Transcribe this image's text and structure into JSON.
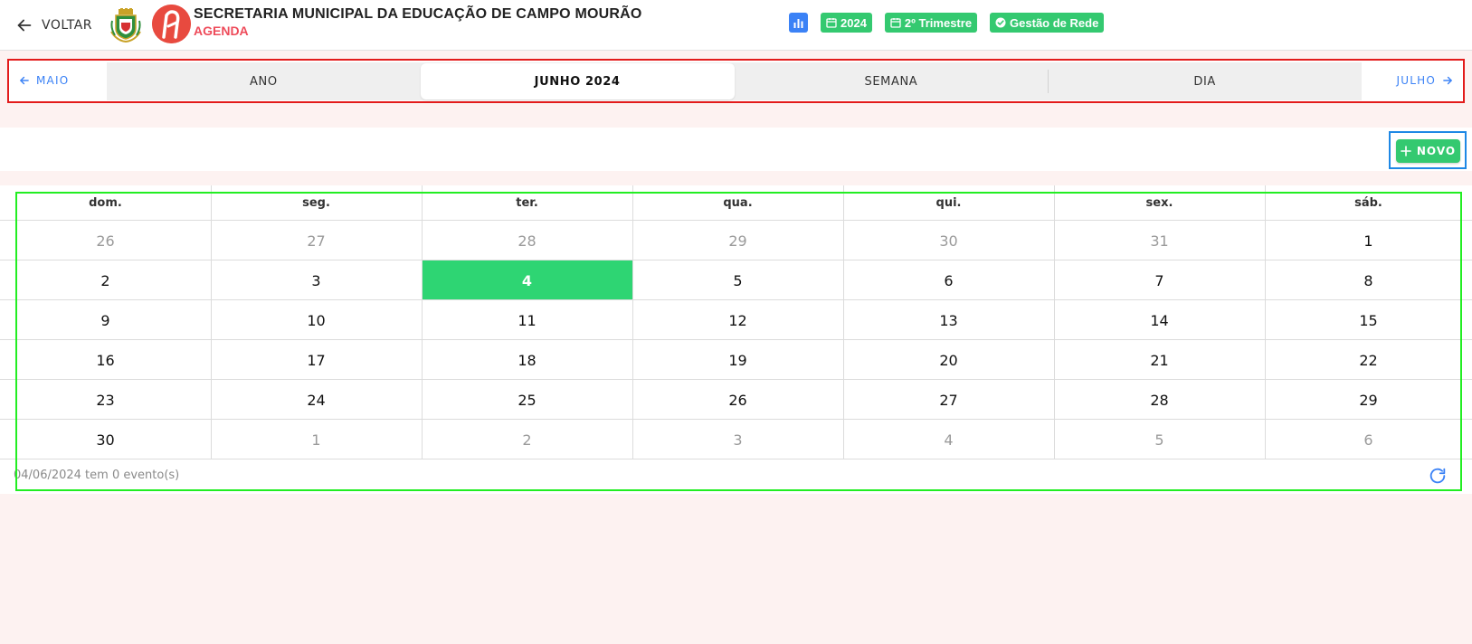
{
  "header": {
    "back_label": "VOLTAR",
    "org_title": "SECRETARIA MUNICIPAL DA EDUCAÇÃO DE CAMPO MOURÃO",
    "org_subtitle": "AGENDA",
    "badges": [
      {
        "icon": "bar-chart-icon",
        "label": ""
      },
      {
        "icon": "calendar-icon",
        "label": "2024"
      },
      {
        "icon": "calendar-icon",
        "label": "2º Trimestre"
      },
      {
        "icon": "check-circle-icon",
        "label": "Gestão de Rede"
      }
    ]
  },
  "nav": {
    "prev_label": "MAIO",
    "next_label": "JULHO",
    "tabs": [
      {
        "label": "ANO",
        "active": false
      },
      {
        "label": "JUNHO 2024",
        "active": true
      },
      {
        "label": "SEMANA",
        "active": false
      },
      {
        "label": "DIA",
        "active": false
      }
    ]
  },
  "toolbar": {
    "new_label": "NOVO"
  },
  "calendar": {
    "weekdays": [
      "dom.",
      "seg.",
      "ter.",
      "qua.",
      "qui.",
      "sex.",
      "sáb."
    ],
    "weeks": [
      [
        {
          "d": "26",
          "o": true
        },
        {
          "d": "27",
          "o": true
        },
        {
          "d": "28",
          "o": true
        },
        {
          "d": "29",
          "o": true
        },
        {
          "d": "30",
          "o": true
        },
        {
          "d": "31",
          "o": true
        },
        {
          "d": "1",
          "o": false
        }
      ],
      [
        {
          "d": "2",
          "o": false
        },
        {
          "d": "3",
          "o": false
        },
        {
          "d": "4",
          "o": false,
          "today": true
        },
        {
          "d": "5",
          "o": false
        },
        {
          "d": "6",
          "o": false
        },
        {
          "d": "7",
          "o": false
        },
        {
          "d": "8",
          "o": false
        }
      ],
      [
        {
          "d": "9",
          "o": false
        },
        {
          "d": "10",
          "o": false
        },
        {
          "d": "11",
          "o": false
        },
        {
          "d": "12",
          "o": false
        },
        {
          "d": "13",
          "o": false
        },
        {
          "d": "14",
          "o": false
        },
        {
          "d": "15",
          "o": false
        }
      ],
      [
        {
          "d": "16",
          "o": false
        },
        {
          "d": "17",
          "o": false
        },
        {
          "d": "18",
          "o": false
        },
        {
          "d": "19",
          "o": false
        },
        {
          "d": "20",
          "o": false
        },
        {
          "d": "21",
          "o": false
        },
        {
          "d": "22",
          "o": false
        }
      ],
      [
        {
          "d": "23",
          "o": false
        },
        {
          "d": "24",
          "o": false
        },
        {
          "d": "25",
          "o": false
        },
        {
          "d": "26",
          "o": false
        },
        {
          "d": "27",
          "o": false
        },
        {
          "d": "28",
          "o": false
        },
        {
          "d": "29",
          "o": false
        }
      ],
      [
        {
          "d": "30",
          "o": false
        },
        {
          "d": "1",
          "o": true
        },
        {
          "d": "2",
          "o": true
        },
        {
          "d": "3",
          "o": true
        },
        {
          "d": "4",
          "o": true
        },
        {
          "d": "5",
          "o": true
        },
        {
          "d": "6",
          "o": true
        }
      ]
    ],
    "footer_text": "04/06/2024 tem 0 evento(s)"
  },
  "colors": {
    "accent_green": "#34c970",
    "today_green": "#2ed573",
    "link_blue": "#3b82f6",
    "subtitle_red": "#ee4b5a"
  }
}
